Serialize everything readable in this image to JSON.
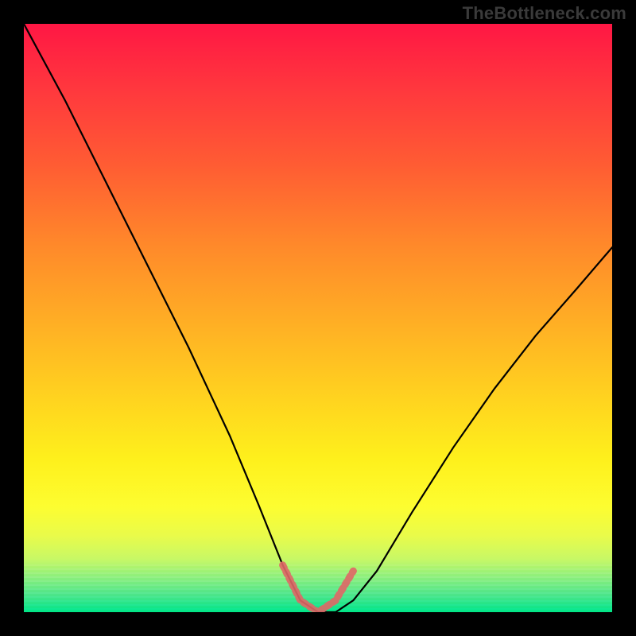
{
  "watermark": "TheBottleneck.com",
  "chart_data": {
    "type": "line",
    "title": "",
    "xlabel": "",
    "ylabel": "",
    "xlim": [
      0,
      1
    ],
    "ylim": [
      0,
      1
    ],
    "series": [
      {
        "name": "bottleneck-curve",
        "x": [
          0.0,
          0.07,
          0.14,
          0.21,
          0.28,
          0.35,
          0.4,
          0.44,
          0.47,
          0.5,
          0.53,
          0.56,
          0.6,
          0.66,
          0.73,
          0.8,
          0.87,
          0.94,
          1.0
        ],
        "values": [
          1.0,
          0.87,
          0.73,
          0.59,
          0.45,
          0.3,
          0.18,
          0.08,
          0.02,
          0.0,
          0.0,
          0.02,
          0.07,
          0.17,
          0.28,
          0.38,
          0.47,
          0.55,
          0.62
        ]
      },
      {
        "name": "trough-highlight",
        "x": [
          0.44,
          0.47,
          0.5,
          0.53,
          0.56
        ],
        "values": [
          0.08,
          0.02,
          0.0,
          0.02,
          0.07
        ]
      }
    ],
    "gradient_stops": [
      {
        "pos": 0.0,
        "color": "#ff1744"
      },
      {
        "pos": 0.5,
        "color": "#ffb224"
      },
      {
        "pos": 0.8,
        "color": "#fdfd30"
      },
      {
        "pos": 1.0,
        "color": "#00e68a"
      }
    ],
    "curve_color": "#000000",
    "highlight_color": "#e06666"
  }
}
